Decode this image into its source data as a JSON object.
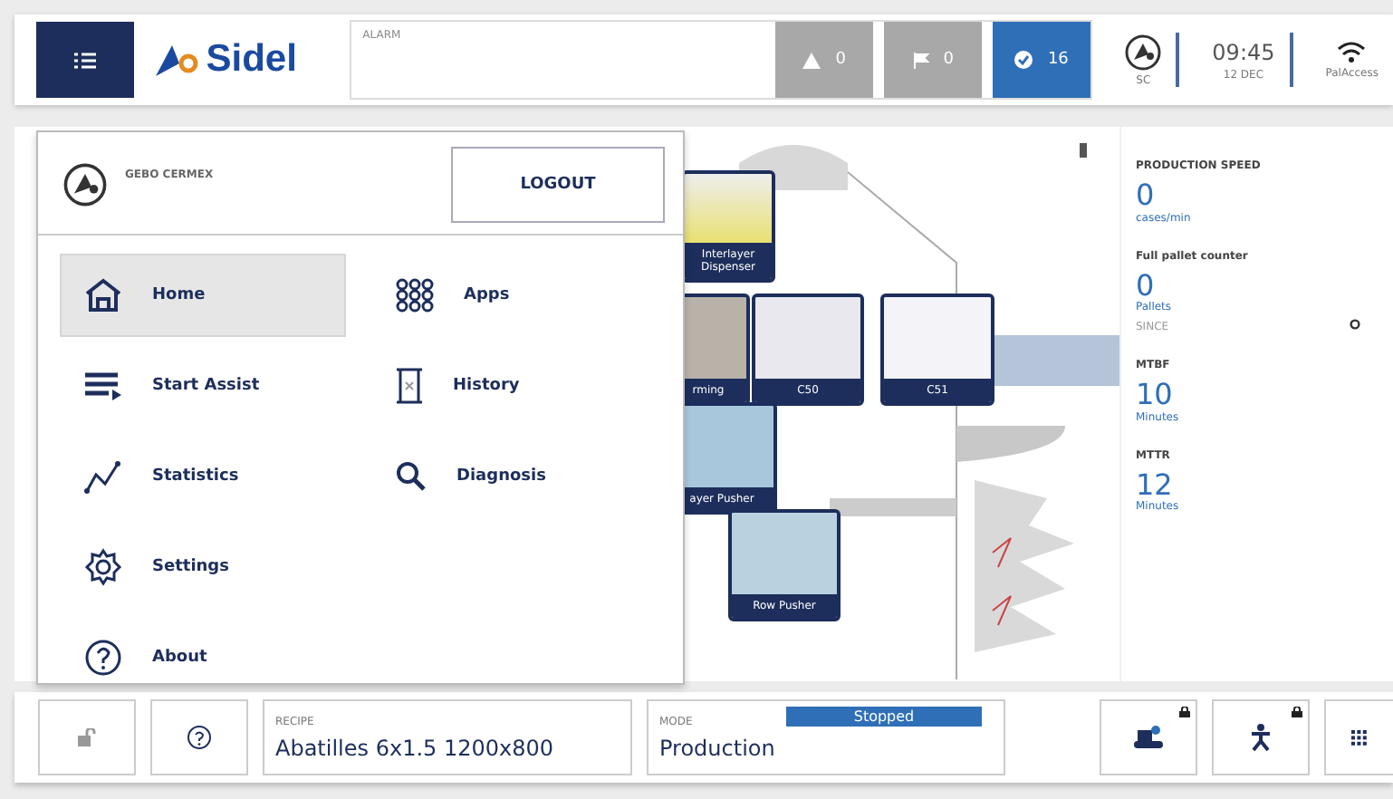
{
  "header": {
    "logo": "Sidel",
    "alarm": {
      "label": "ALARM",
      "counters": [
        {
          "kind": "warning",
          "count": "0",
          "active": false
        },
        {
          "kind": "flag",
          "count": "0",
          "active": false
        },
        {
          "kind": "ok",
          "count": "16",
          "active": true
        }
      ]
    },
    "user": {
      "label": "SC"
    },
    "clock": {
      "time": "09:45",
      "date": "12 DEC"
    },
    "network": {
      "name": "PalAccess"
    }
  },
  "menu": {
    "company": "GEBO CERMEX",
    "logout": "LOGOUT",
    "columns": [
      [
        {
          "label": "Home",
          "kind": "home",
          "selected": true
        },
        {
          "label": "Start Assist",
          "kind": "assist",
          "selected": false
        },
        {
          "label": "Statistics",
          "kind": "statistics",
          "selected": false
        },
        {
          "label": "Settings",
          "kind": "settings",
          "selected": false
        },
        {
          "label": "About",
          "kind": "about",
          "selected": false
        }
      ],
      [
        {
          "label": "Apps",
          "kind": "apps",
          "selected": false
        },
        {
          "label": "History",
          "kind": "history",
          "selected": false
        },
        {
          "label": "Diagnosis",
          "kind": "diagnosis",
          "selected": false
        }
      ]
    ]
  },
  "stations": [
    {
      "label": "Interlayer Dispenser"
    },
    {
      "label": "rming"
    },
    {
      "label": "C50"
    },
    {
      "label": "C51"
    },
    {
      "label": "ayer Pusher"
    },
    {
      "label": "Row Pusher"
    }
  ],
  "stats": [
    {
      "title": "PRODUCTION SPEED",
      "value": "0",
      "unit": "cases/min"
    },
    {
      "title": "Full pallet counter",
      "value": "0",
      "unit": "Pallets",
      "since": "SINCE"
    },
    {
      "title": "MTBF",
      "value": "10",
      "unit": "Minutes"
    },
    {
      "title": "MTTR",
      "value": "12",
      "unit": "Minutes"
    }
  ],
  "footer": {
    "recipe": {
      "label": "RECIPE",
      "value": "Abatilles 6x1.5 1200x800"
    },
    "mode": {
      "label": "MODE",
      "value": "Production",
      "status": "Stopped"
    }
  }
}
